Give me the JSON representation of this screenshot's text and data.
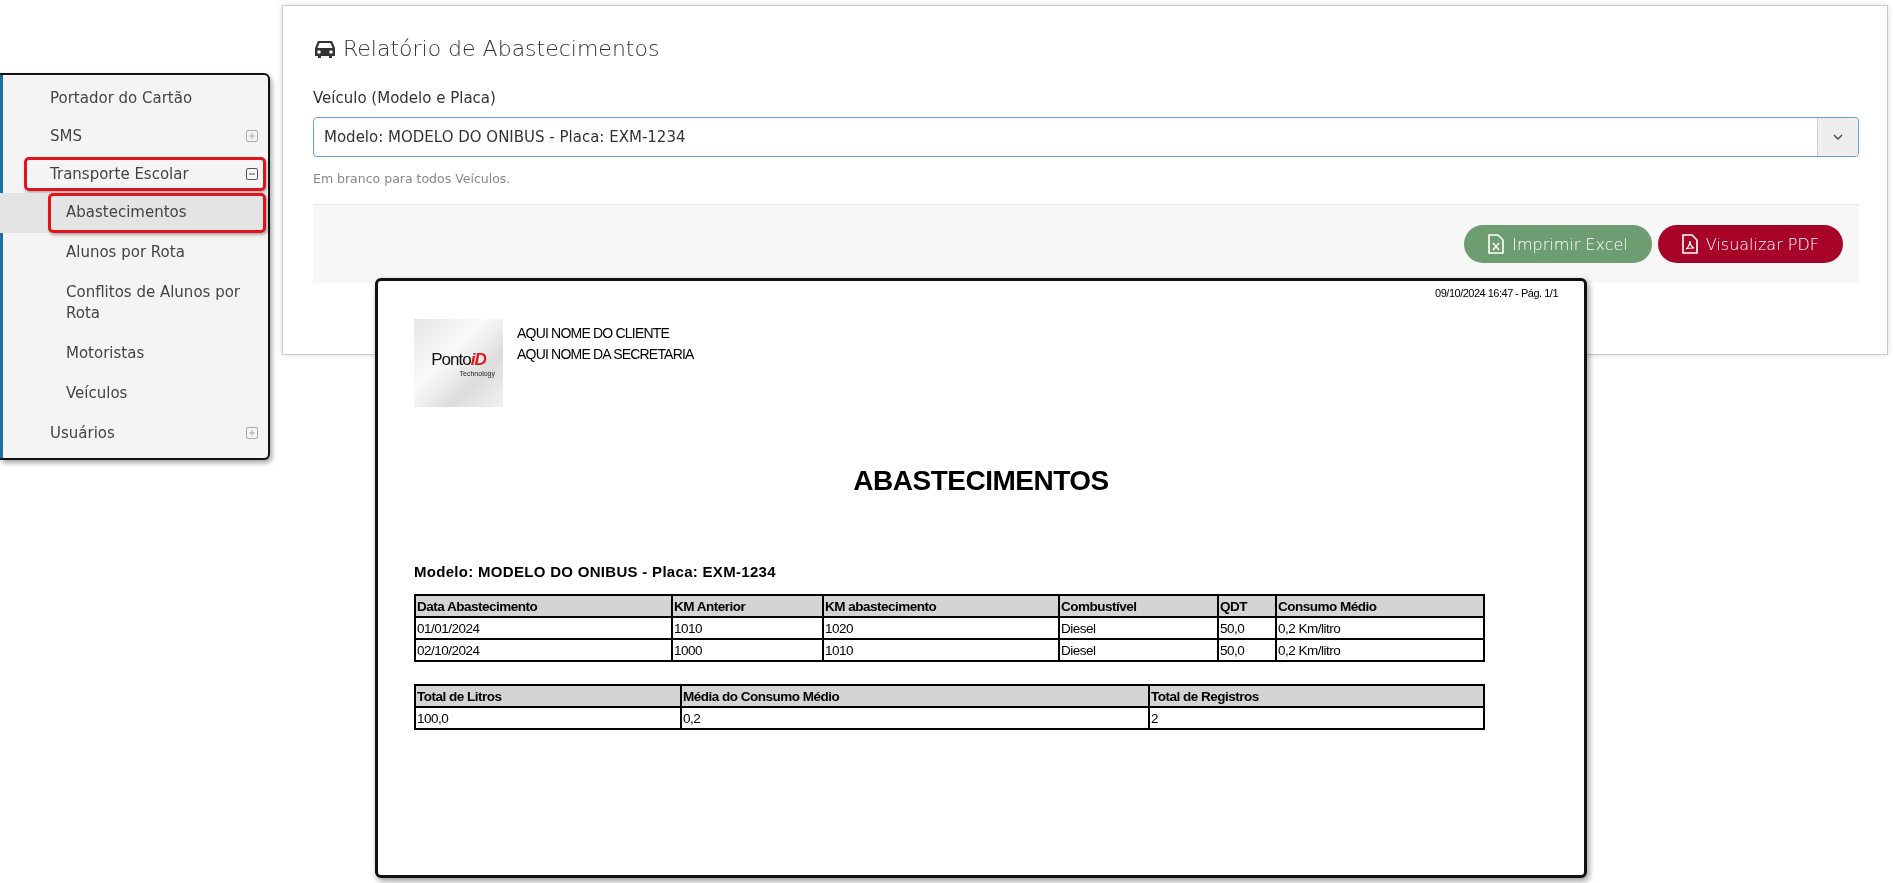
{
  "sidebar": {
    "items": [
      {
        "label": "Portador do Cartão",
        "kind": "link",
        "selected": false,
        "highlighted": false
      },
      {
        "label": "SMS",
        "kind": "group",
        "expanded": false,
        "highlighted": false
      },
      {
        "label": "Transporte Escolar",
        "kind": "group",
        "expanded": true,
        "highlighted": true,
        "children": [
          {
            "label": "Abastecimentos",
            "selected": true,
            "highlighted": true
          },
          {
            "label": "Alunos por Rota",
            "selected": false,
            "highlighted": false
          },
          {
            "label": "Conflitos de Alunos por Rota",
            "selected": false,
            "highlighted": false
          },
          {
            "label": "Motoristas",
            "selected": false,
            "highlighted": false
          },
          {
            "label": "Veículos",
            "selected": false,
            "highlighted": false
          }
        ]
      },
      {
        "label": "Usuários",
        "kind": "group",
        "expanded": false,
        "highlighted": false
      }
    ]
  },
  "form": {
    "title": "Relatório de Abastecimentos",
    "field_label": "Veículo (Modelo e Placa)",
    "select_value": "Modelo: MODELO DO ONIBUS - Placa: EXM-1234",
    "hint": "Em branco para todos Veículos.",
    "buttons": [
      {
        "label": "Imprimir Excel",
        "kind": "excel"
      },
      {
        "label": "Visualizar PDF",
        "kind": "pdf"
      }
    ]
  },
  "report": {
    "timestamp": "09/10/2024 16:47 - Pág. 1/1",
    "logo": {
      "word": "Ponto",
      "accent": "iD",
      "tagline": "Technology"
    },
    "header_lines": [
      "AQUI NOME DO CLIENTE",
      "AQUI NOME DA SECRETARIA"
    ],
    "title": "ABASTECIMENTOS",
    "subtitle": "Modelo: MODELO DO ONIBUS - Placa: EXM-1234",
    "table": {
      "columns": [
        "Data Abastecimento",
        "KM Anterior",
        "KM abastecimento",
        "Combustível",
        "QDT",
        "Consumo Médio"
      ],
      "rows": [
        [
          "01/01/2024",
          "1010",
          "1020",
          "Diesel",
          "50,0",
          "0,2 Km/litro"
        ],
        [
          "02/10/2024",
          "1000",
          "1010",
          "Diesel",
          "50,0",
          "0,2 Km/litro"
        ]
      ]
    },
    "totals": {
      "columns": [
        "Total de Litros",
        "Média do Consumo Médio",
        "Total de Registros"
      ],
      "rows": [
        [
          "100,0",
          "0,2",
          "2"
        ]
      ]
    }
  }
}
